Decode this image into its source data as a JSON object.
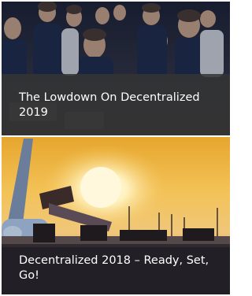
{
  "articles": [
    {
      "title": "The Lowdown On Decentralized 2019",
      "image_icon": "conference-audience-photo",
      "overlay_color": "#343434"
    },
    {
      "title": "Decentralized 2018 – Ready, Set, Go!",
      "image_icon": "airport-sunset-photo",
      "accent_color": "#f2b43a"
    }
  ]
}
